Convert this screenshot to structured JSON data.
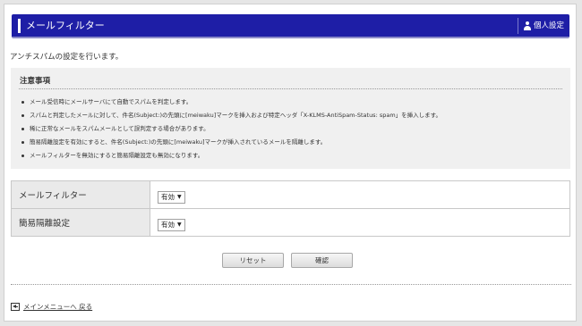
{
  "header": {
    "title": "メールフィルター",
    "personal_settings": "個人設定"
  },
  "description": "アンチスパムの設定を行います。",
  "notice": {
    "title": "注意事項",
    "items": [
      "メール受信時にメールサーバにて自動でスパムを判定します。",
      "スパムと判定したメールに対して、件名(Subject:)の先頭に[meiwaku]マークを挿入および特定ヘッダ「X-KLMS-AntiSpam-Status: spam」を挿入します。",
      "稀に正常なメールをスパムメールとして誤判定する場合があります。",
      "簡易隔離設定を有効にすると、件名(Subject:)の先頭に[meiwaku]マークが挿入されているメールを隔離します。",
      "メールフィルターを無効にすると簡易隔離設定も無効になります。"
    ]
  },
  "settings": [
    {
      "label": "メールフィルター",
      "value": "有効"
    },
    {
      "label": "簡易隔離設定",
      "value": "有効"
    }
  ],
  "buttons": {
    "reset": "リセット",
    "confirm": "確認"
  },
  "footer": {
    "back_link": "メインメニューへ 戻る"
  }
}
